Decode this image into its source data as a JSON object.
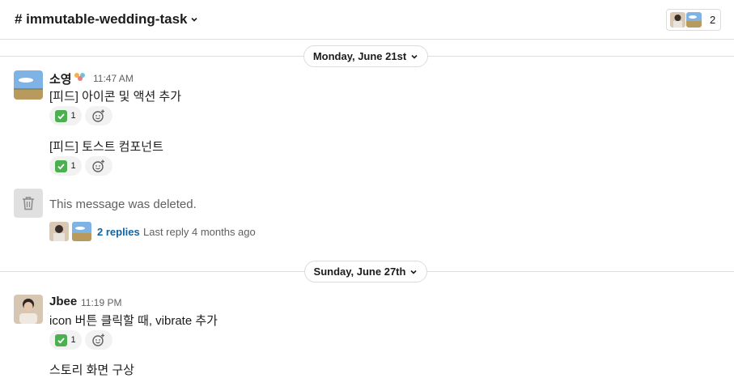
{
  "header": {
    "channel_name": "# immutable-wedding-task",
    "member_count": "2"
  },
  "dividers": {
    "first": "Monday, June 21st",
    "second": "Sunday, June 27th"
  },
  "messages": [
    {
      "sender": "소영",
      "time": "11:47 AM",
      "lines": [
        {
          "text": "[피드] 아이콘 및 액션 추가",
          "reaction": {
            "emoji": "white-check-mark",
            "count": "1"
          }
        },
        {
          "text": "[피드] 토스트 컴포넌트",
          "reaction": {
            "emoji": "white-check-mark",
            "count": "1"
          }
        }
      ]
    },
    {
      "deleted_text": "This message was deleted.",
      "replies": "2 replies",
      "last_reply": "Last reply 4 months ago"
    },
    {
      "sender": "Jbee",
      "time": "11:19 PM",
      "lines": [
        {
          "text": "icon 버튼 클릭할 때, vibrate 추가",
          "reaction": {
            "emoji": "white-check-mark",
            "count": "1"
          }
        },
        {
          "text": "스토리 화면 구상"
        }
      ]
    }
  ],
  "colors": {
    "link": "#1264a3",
    "reaction_bg": "#f2f2f2",
    "divider": "#dddddd"
  }
}
